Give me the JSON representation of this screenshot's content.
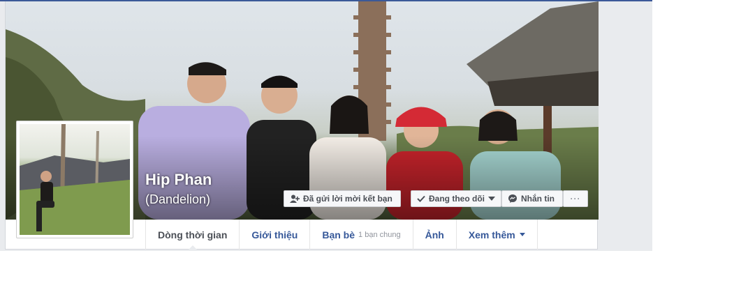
{
  "profile": {
    "name": "Hip Phan",
    "alternate_name": "(Dandelion)"
  },
  "actions": {
    "friend_request": "Đã gửi lời mời kết bạn",
    "following": "Đang theo dõi",
    "message": "Nhắn tin",
    "more": "···"
  },
  "tabs": [
    {
      "label": "Dòng thời gian",
      "active": true
    },
    {
      "label": "Giới thiệu"
    },
    {
      "label": "Bạn bè",
      "sub": "1 bạn chung"
    },
    {
      "label": "Ảnh"
    },
    {
      "label": "Xem thêm"
    }
  ],
  "colors": {
    "link": "#365899",
    "header_bar": "#3b5998",
    "page_background": "#e9ebee"
  },
  "icons": [
    "add-friend-icon",
    "checkmark-icon",
    "caret-down-icon",
    "messenger-icon",
    "more-dots-icon"
  ]
}
